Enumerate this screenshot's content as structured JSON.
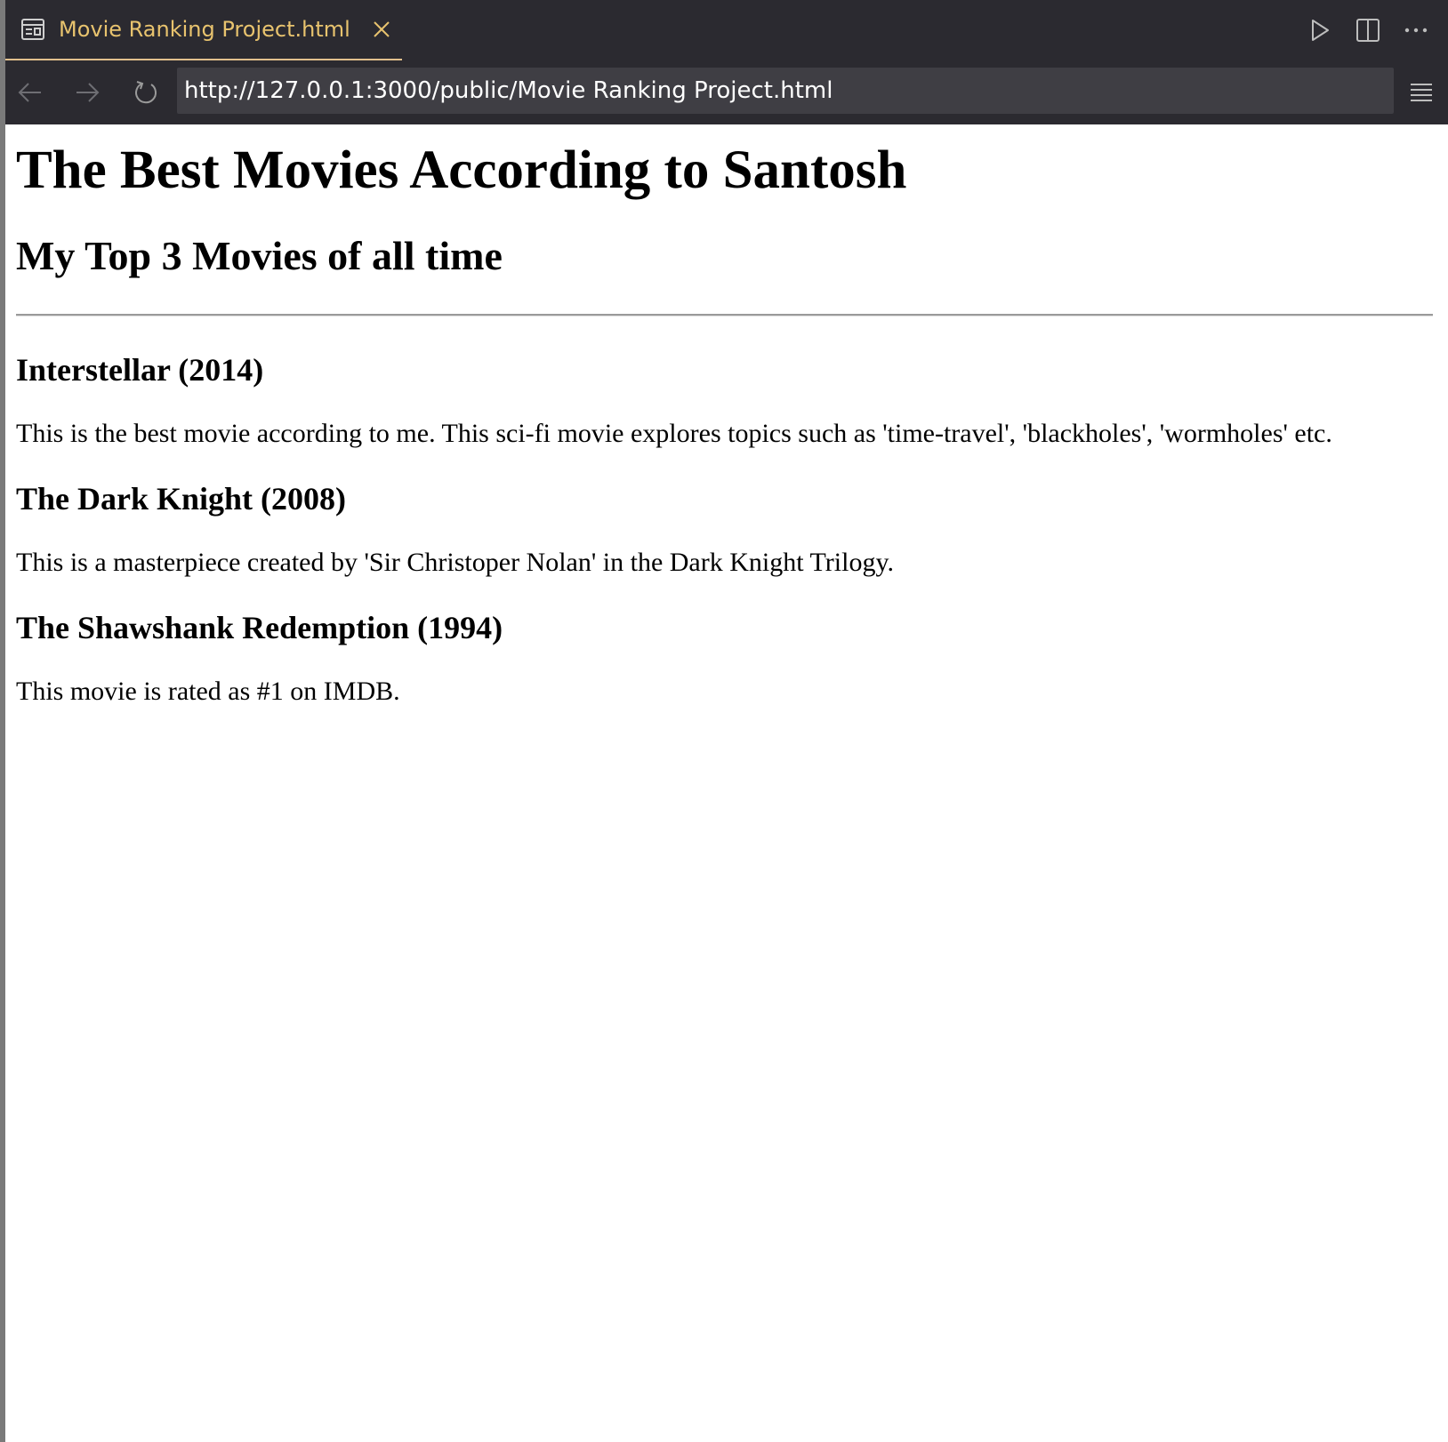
{
  "browser": {
    "tab": {
      "title": "Movie Ranking Project.html",
      "icon": "preview-icon"
    },
    "actions": [
      "run-icon",
      "split-editor-icon",
      "more-icon"
    ],
    "nav": {
      "url": "http://127.0.0.1:3000/public/Movie Ranking Project.html"
    },
    "colors": {
      "chrome_bg": "#2b2a30",
      "tab_text": "#e8c36e",
      "url_bg": "#3f3e44"
    }
  },
  "page": {
    "title": "The Best Movies According to Santosh",
    "subtitle": "My Top 3 Movies of all time",
    "movies": [
      {
        "heading": "Interstellar (2014)",
        "description": "This is the best movie according to me. This sci-fi movie explores topics such as 'time-travel', 'blackholes', 'wormholes' etc."
      },
      {
        "heading": "The Dark Knight (2008)",
        "description": "This is a masterpiece created by 'Sir Christoper Nolan' in the Dark Knight Trilogy."
      },
      {
        "heading": "The Shawshank Redemption (1994)",
        "description": "This movie is rated as #1 on IMDB."
      }
    ]
  }
}
